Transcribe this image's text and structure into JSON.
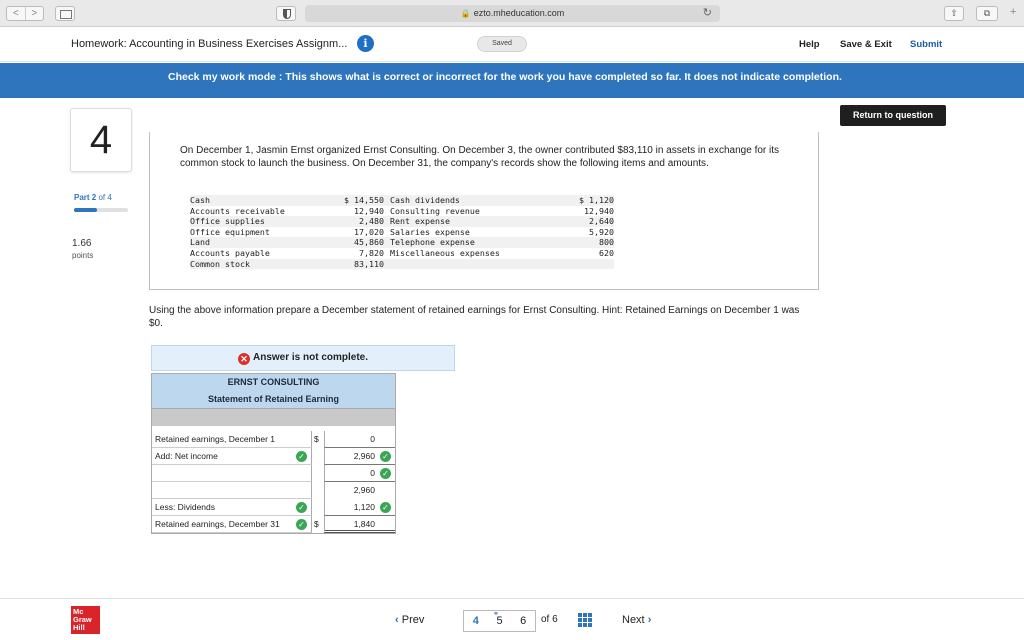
{
  "browser": {
    "url": "ezto.mheducation.com",
    "nav_back": "<",
    "nav_forward": ">"
  },
  "header": {
    "title": "Homework: Accounting in Business Exercises Assignm...",
    "info_icon": "i",
    "saved": "Saved",
    "help": "Help",
    "save_exit": "Save & Exit",
    "submit": "Submit"
  },
  "banner": {
    "text": "Check my work mode : This shows what is correct or incorrect for the work you have completed so far. It does not indicate completion."
  },
  "return_button": "Return to question",
  "question": {
    "number": "4",
    "part_label": "Part 2",
    "part_of": "of 4",
    "progress": 0.5,
    "points": "1.66",
    "points_label": "points"
  },
  "problem": {
    "text": "On December 1, Jasmin Ernst organized Ernst Consulting. On December 3, the owner contributed $83,110 in assets in exchange for its common stock to launch the business. On December 31, the company's records show the following items and amounts.",
    "ledger": [
      {
        "a": "Cash",
        "av": "$ 14,550",
        "b": "Cash dividends",
        "bv": "$ 1,120"
      },
      {
        "a": "Accounts receivable",
        "av": "12,940",
        "b": "Consulting revenue",
        "bv": "12,940"
      },
      {
        "a": "Office supplies",
        "av": "2,480",
        "b": "Rent expense",
        "bv": "2,640"
      },
      {
        "a": "Office equipment",
        "av": "17,020",
        "b": "Salaries expense",
        "bv": "5,920"
      },
      {
        "a": "Land",
        "av": "45,860",
        "b": "Telephone expense",
        "bv": "800"
      },
      {
        "a": "Accounts payable",
        "av": "7,820",
        "b": "Miscellaneous expenses",
        "bv": "620"
      },
      {
        "a": "Common stock",
        "av": "83,110",
        "b": "",
        "bv": ""
      }
    ]
  },
  "instruction": "Using the above information prepare a December statement of retained earnings for Ernst Consulting. Hint: Retained Earnings on December 1 was $0.",
  "answer_status": "Answer is not complete.",
  "statement": {
    "company": "ERNST CONSULTING",
    "title": "Statement of Retained Earning",
    "rows": {
      "r1_label": "Retained earnings, December 1",
      "r1_cur": "$",
      "r1_amt": "0",
      "r2_label": "Add: Net income",
      "r2_amt": "2,960",
      "r3_amt": "0",
      "r4_amt": "2,960",
      "r5_label": "Less: Dividends",
      "r5_amt": "1,120",
      "r6_label": "Retained earnings, December 31",
      "r6_cur": "$",
      "r6_amt": "1,840"
    }
  },
  "footer": {
    "logo_lines": [
      "Mc",
      "Graw",
      "Hill"
    ],
    "prev": "Prev",
    "pages": [
      "4",
      "5",
      "6"
    ],
    "current_page": "5",
    "of": "of 6",
    "next": "Next"
  }
}
